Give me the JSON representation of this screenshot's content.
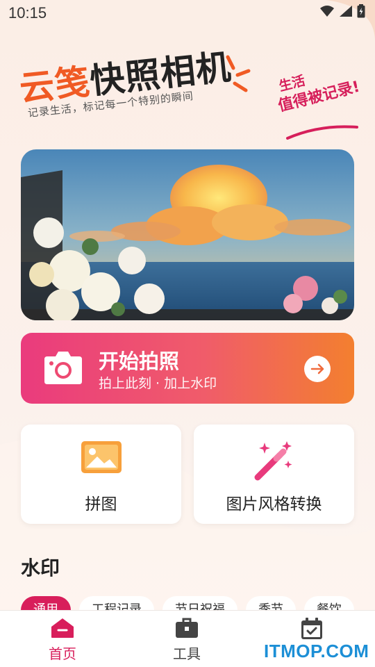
{
  "status_bar": {
    "time": "10:15"
  },
  "header": {
    "title_part1": "云笺",
    "title_part2": "快照相机",
    "slogan": "记录生活，标记每一个特别的瞬间",
    "side_tag_line1": "生活",
    "side_tag_line2": "值得被记录!"
  },
  "shoot_button": {
    "title": "开始拍照",
    "subtitle": "拍上此刻 · 加上水印"
  },
  "features": [
    {
      "label": "拼图",
      "icon": "image-icon"
    },
    {
      "label": "图片风格转换",
      "icon": "magic-wand-icon"
    }
  ],
  "watermark_section": {
    "title": "水印",
    "chips": [
      "通用",
      "工程记录",
      "节日祝福",
      "季节",
      "餐饮"
    ]
  },
  "bottom_nav": [
    {
      "label": "首页",
      "icon": "home-icon",
      "active": true
    },
    {
      "label": "工具",
      "icon": "toolbox-icon",
      "active": false
    },
    {
      "label": "",
      "icon": "calendar-check-icon",
      "active": false
    }
  ],
  "overlay_watermark": "ITMOP.COM",
  "colors": {
    "accent": "#d81e5b",
    "orange": "#f05a24",
    "gradient_start": "#ea3b7d",
    "gradient_end": "#f37f2f"
  }
}
